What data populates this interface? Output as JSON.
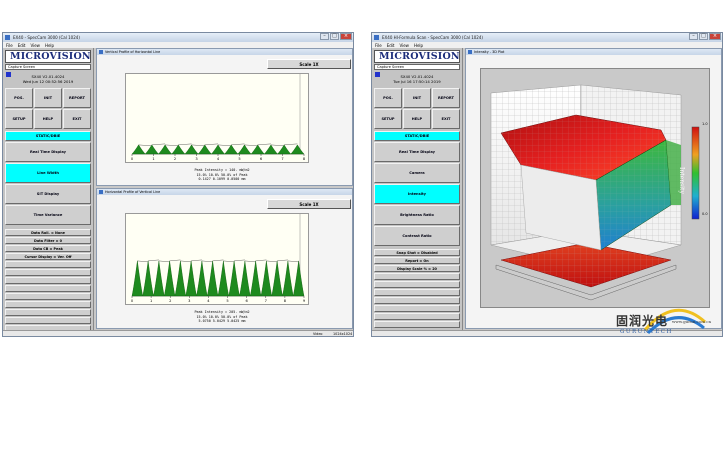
{
  "left_window": {
    "title": "EX40 - SpecCam 3000 (Cal 1024)",
    "menu": [
      "File",
      "Edit",
      "View",
      "Help"
    ],
    "logo": "MICROVISION",
    "capture": "Capture Screen",
    "version": "SX40 V2.01.4024",
    "date": "Wed Jun 12 00:52:56 2019",
    "buttons_row1": [
      "POS.",
      "INIT",
      "REPORT"
    ],
    "buttons_row2": [
      "SETUP",
      "HELP",
      "EXIT"
    ],
    "mode_buttons": [
      "STATIC/DBIE",
      "Real Time Display",
      "Line Width",
      "SIT Display",
      "Time Variance"
    ],
    "settings": [
      "Data Roll. = None",
      "Data Filter = 0",
      "Data CB = Peak",
      "Cursor Display = Ver. Off"
    ],
    "panel1": {
      "title": "Vertical Profile of Horizontal Line",
      "scale_button": "Scale 1X",
      "x_ticks": [
        "0",
        "1",
        "2",
        "3",
        "4",
        "5",
        "6",
        "7",
        "8"
      ],
      "readout": [
        "Peak Intensity = 140. mW/m2",
        "15.0%   10.0%   50.0% of Peak",
        "0.1427  0.1099  0.0500 mm"
      ]
    },
    "panel2": {
      "title": "Horizontal Profile of Vertical Line",
      "scale_button": "Scale 1X",
      "x_ticks": [
        "0",
        "1",
        "2",
        "3",
        "4",
        "5",
        "6",
        "7",
        "8",
        "9"
      ],
      "readout": [
        "Peak Intensity = 205. mW/m2",
        "15.0%   10.0%   50.0% of Peak",
        "5.0750  5.0429  5.0425 mm"
      ]
    },
    "status": [
      "Video",
      "1024x1024"
    ]
  },
  "right_window": {
    "title": "EX40 HI-Formula Scan - SpecCam 3000 (Cal 1024)",
    "menu": [
      "File",
      "Edit",
      "View",
      "Help"
    ],
    "logo": "MICROVISION",
    "capture": "Capture Screen",
    "version": "SX40 V2.01.4024",
    "date": "Tue Jul 16 17:50:14 2019",
    "buttons_row1": [
      "POS.",
      "INIT",
      "REPORT"
    ],
    "buttons_row2": [
      "SETUP",
      "HELP",
      "EXIT"
    ],
    "mode_buttons": [
      "STATIC/DBIE",
      "Real Time Display",
      "Camera",
      "Intensity",
      "Brightness Ratio",
      "Contrast Ratio"
    ],
    "settings": [
      "Snap Shot = Disabled",
      "Report = On",
      "Display Scale % = 20"
    ],
    "panel": {
      "title": "Intensity - 3D Plot",
      "axis_label": "Intensity",
      "legend_ticks": [
        "1.0",
        "",
        "",
        "",
        "",
        "",
        "",
        "",
        "0.0"
      ]
    }
  },
  "watermark": {
    "cn": "固润光电",
    "en": "GURUNTECH",
    "url": "www.gurun.com.cn"
  },
  "chart_data": [
    {
      "type": "area",
      "title": "Vertical Profile of Horizontal Line",
      "x_ticks": [
        "0",
        "1",
        "2",
        "3",
        "4",
        "5",
        "6",
        "7",
        "8"
      ],
      "peaks": 13,
      "peak_level": 0.12
    },
    {
      "type": "area",
      "title": "Horizontal Profile of Vertical Line",
      "x_ticks": [
        "0",
        "1",
        "2",
        "3",
        "4",
        "5",
        "6",
        "7",
        "8",
        "9"
      ],
      "peaks": 16,
      "peak_level": 0.45
    }
  ],
  "colors": {
    "cyan": "#00ffff",
    "green": "#1e8a1e",
    "red": "#e01010"
  }
}
